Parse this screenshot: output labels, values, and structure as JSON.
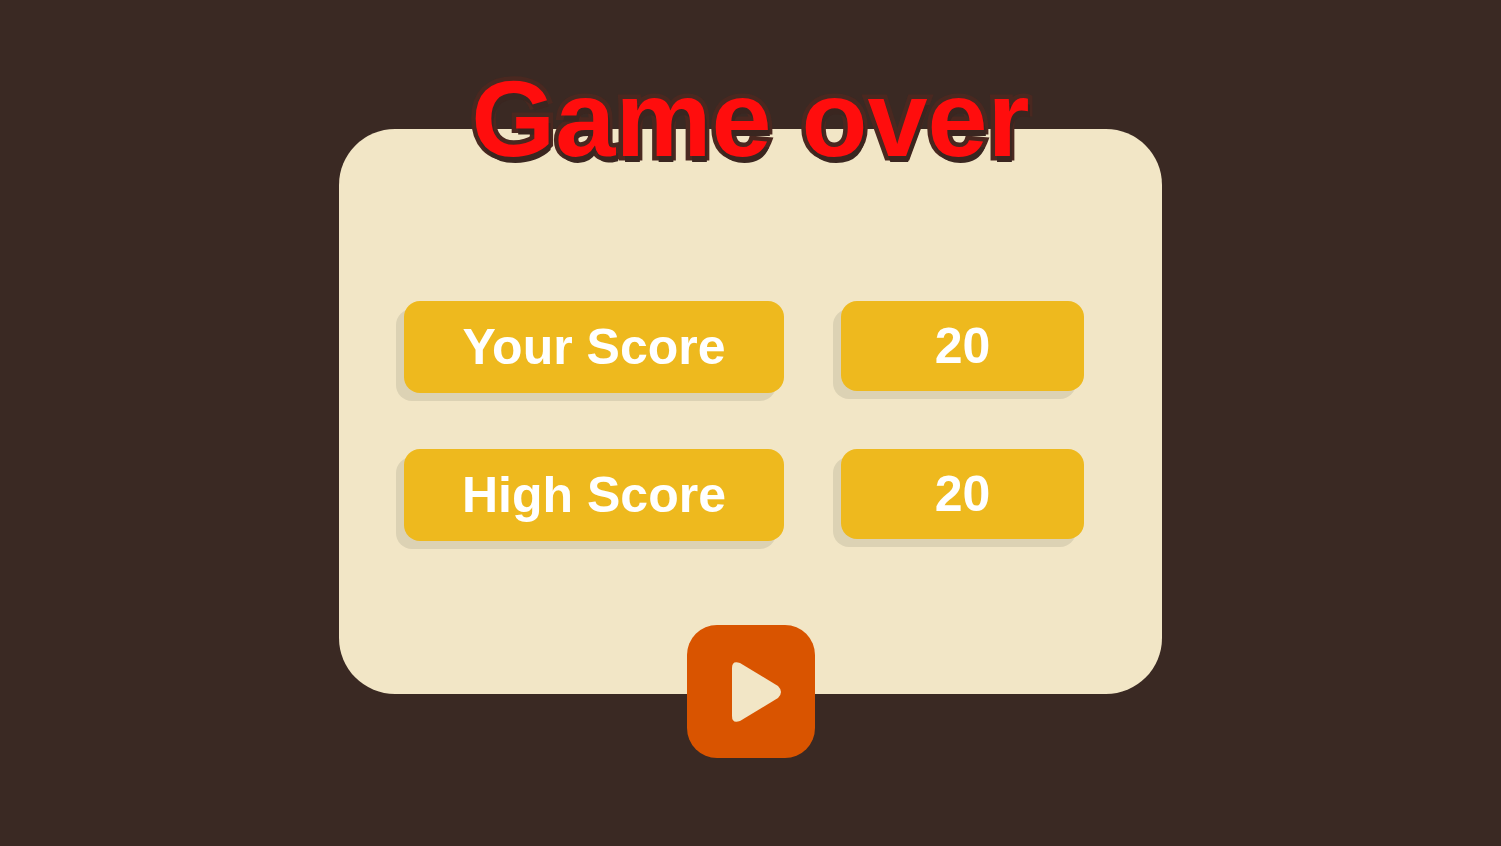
{
  "title": "Game over",
  "scores": [
    {
      "label": "Your Score",
      "value": "20"
    },
    {
      "label": "High Score",
      "value": "20"
    }
  ]
}
